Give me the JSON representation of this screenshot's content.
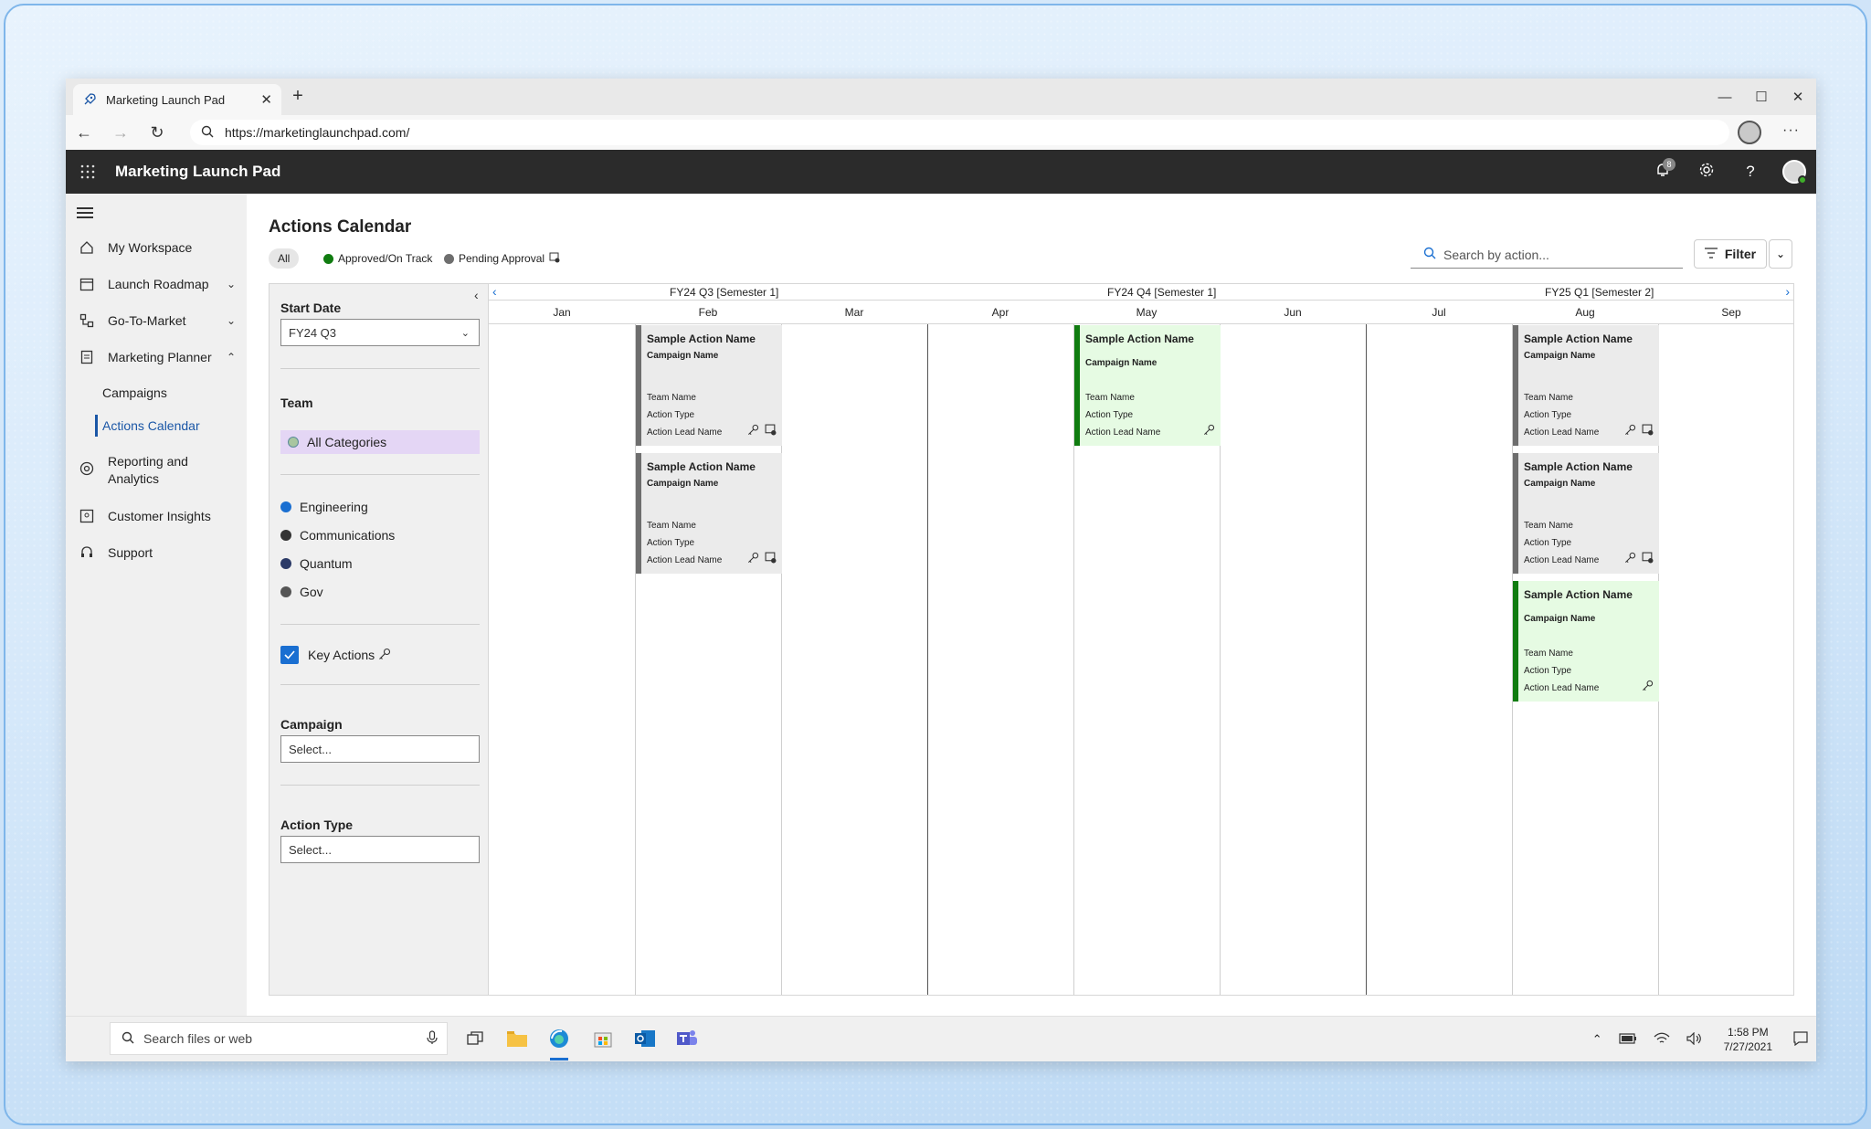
{
  "browser": {
    "tab_title": "Marketing Launch Pad",
    "url": "https://marketinglaunchpad.com/"
  },
  "app": {
    "title": "Marketing Launch Pad",
    "notification_count": "8"
  },
  "nav": {
    "items": [
      {
        "label": "My Workspace",
        "icon": "home-icon"
      },
      {
        "label": "Launch Roadmap",
        "icon": "calendar-icon"
      },
      {
        "label": "Go-To-Market",
        "icon": "flow-icon"
      },
      {
        "label": "Marketing Planner",
        "icon": "planner-icon"
      },
      {
        "label": "Reporting and Analytics",
        "icon": "analytics-icon"
      },
      {
        "label": "Customer Insights",
        "icon": "insights-icon"
      },
      {
        "label": "Support",
        "icon": "support-icon"
      }
    ],
    "sub_items": [
      "Campaigns",
      "Actions Calendar"
    ]
  },
  "page": {
    "title": "Actions Calendar",
    "status_filters": [
      "All",
      "Approved/On Track",
      "Pending Approval"
    ],
    "search_placeholder": "Search by action...",
    "filter_label": "Filter"
  },
  "filters": {
    "start_date_label": "Start Date",
    "start_date_value": "FY24 Q3",
    "team_label": "Team",
    "all_categories": "All Categories",
    "categories": [
      {
        "name": "Engineering",
        "color": "#1a6fd1"
      },
      {
        "name": "Communications",
        "color": "#333333"
      },
      {
        "name": "Quantum",
        "color": "#2b3a67"
      },
      {
        "name": "Gov",
        "color": "#555555"
      }
    ],
    "key_actions_label": "Key Actions",
    "campaign_label": "Campaign",
    "campaign_placeholder": "Select...",
    "action_type_label": "Action Type",
    "action_type_placeholder": "Select..."
  },
  "calendar": {
    "quarters": [
      "FY24 Q3 [Semester 1]",
      "FY24 Q4 [Semester 1]",
      "FY25 Q1 [Semester 2]"
    ],
    "months": [
      "Jan",
      "Feb",
      "Mar",
      "Apr",
      "May",
      "Jun",
      "Jul",
      "Aug",
      "Sep"
    ],
    "cards": [
      {
        "month": "Feb",
        "status": "pending",
        "name": "Sample Action Name",
        "campaign": "Campaign Name",
        "team": "Team Name",
        "type": "Action Type",
        "lead": "Action Lead Name",
        "key": true,
        "flag": true
      },
      {
        "month": "Feb",
        "status": "pending",
        "name": "Sample Action Name",
        "campaign": "Campaign Name",
        "team": "Team Name",
        "type": "Action Type",
        "lead": "Action Lead Name",
        "key": true,
        "flag": true
      },
      {
        "month": "May",
        "status": "approved",
        "name": "Sample Action Name",
        "campaign": "Campaign Name",
        "team": "Team Name",
        "type": "Action Type",
        "lead": "Action Lead Name",
        "key": true,
        "flag": false
      },
      {
        "month": "Aug",
        "status": "pending",
        "name": "Sample Action Name",
        "campaign": "Campaign Name",
        "team": "Team Name",
        "type": "Action Type",
        "lead": "Action Lead Name",
        "key": true,
        "flag": true
      },
      {
        "month": "Aug",
        "status": "pending",
        "name": "Sample Action Name",
        "campaign": "Campaign Name",
        "team": "Team Name",
        "type": "Action Type",
        "lead": "Action Lead Name",
        "key": true,
        "flag": true
      },
      {
        "month": "Aug",
        "status": "approved",
        "name": "Sample Action Name",
        "campaign": "Campaign Name",
        "team": "Team Name",
        "type": "Action Type",
        "lead": "Action Lead Name",
        "key": true,
        "flag": false
      }
    ]
  },
  "taskbar": {
    "search_placeholder": "Search files or web",
    "time": "1:58 PM",
    "date": "7/27/2021"
  },
  "colors": {
    "approved": "#107c10",
    "pending": "#6e6e6e",
    "accent": "#1a6fd1",
    "header": "#2b2b2b"
  }
}
